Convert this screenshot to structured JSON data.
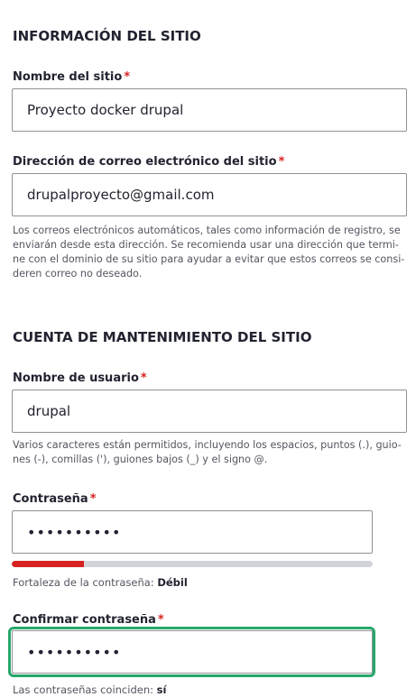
{
  "site_info": {
    "section_title": "INFORMACIÓN DEL SITIO",
    "site_name_label": "Nombre del sitio",
    "site_name_value": "Proyecto docker drupal",
    "email_label": "Dirección de correo electrónico del sitio",
    "email_value": "drupalproyecto@gmail.com",
    "email_description_lines": [
      "Los correos electrónicos automáticos, tales como información de registro, se",
      "enviarán desde esta dirección. Se recomienda usar una dirección que termi-",
      "ne con el dominio de su sitio para ayudar a evitar que estos correos se consi-",
      "deren correo no deseado."
    ]
  },
  "maintenance_account": {
    "section_title": "CUENTA DE MANTENIMIENTO DEL SITIO",
    "username_label": "Nombre de usuario",
    "username_value": "drupal",
    "username_description_lines": [
      "Varios caracteres están permitidos, incluyendo los espacios, puntos (.), guio-",
      "nes (-), comillas ('), guiones bajos (_) y el signo @."
    ],
    "password_label": "Contraseña",
    "password_value": "••••••••••",
    "password_strength_prefix": "Fortaleza de la contraseña:",
    "password_strength_value": "Débil",
    "password_strength_fraction": 0.2,
    "confirm_password_label": "Confirmar contraseña",
    "confirm_password_value": "••••••••••",
    "passwords_match_prefix": "Las contraseñas coinciden:",
    "passwords_match_value": "sí"
  },
  "required_marker": "*",
  "colors": {
    "required": "#d72222",
    "strength_weak": "#d72222",
    "focus_ring": "#26a769",
    "input_border": "#919297"
  }
}
